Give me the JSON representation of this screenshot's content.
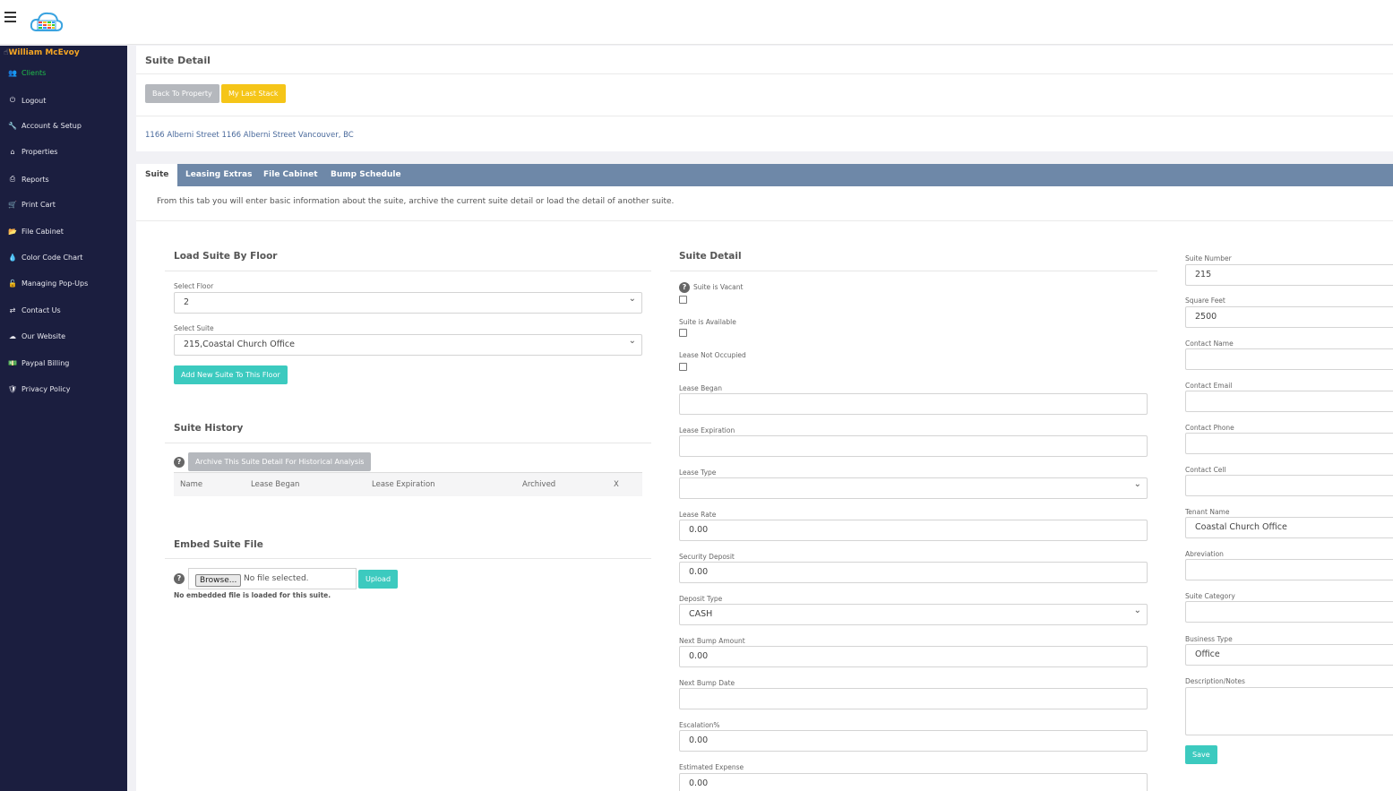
{
  "sidebar": {
    "user_name": "William McEvoy",
    "items": [
      {
        "label": "Clients",
        "icon": "users-icon",
        "glyph": "👥",
        "active": true
      },
      {
        "label": "Logout",
        "icon": "power-icon",
        "glyph": "⏻"
      },
      {
        "label": "Account & Setup",
        "icon": "wrench-icon",
        "glyph": "🔧"
      },
      {
        "label": "Properties",
        "icon": "home-icon",
        "glyph": "⌂"
      },
      {
        "label": "Reports",
        "icon": "print-icon",
        "glyph": "⎙"
      },
      {
        "label": "Print Cart",
        "icon": "cart-icon",
        "glyph": "🛒"
      },
      {
        "label": "File Cabinet",
        "icon": "folder-icon",
        "glyph": "📂"
      },
      {
        "label": "Color Code Chart",
        "icon": "drop-icon",
        "glyph": "💧"
      },
      {
        "label": "Managing Pop-Ups",
        "icon": "lock-icon",
        "glyph": "🔓"
      },
      {
        "label": "Contact Us",
        "icon": "exchange-icon",
        "glyph": "⇄"
      },
      {
        "label": "Our Website",
        "icon": "cloud-icon",
        "glyph": "☁"
      },
      {
        "label": "Paypal Billing",
        "icon": "money-icon",
        "glyph": "💵"
      },
      {
        "label": "Privacy Policy",
        "icon": "shield-icon",
        "glyph": "🛡"
      }
    ]
  },
  "header": {
    "title": "Suite Detail",
    "back_button": "Back To Property",
    "stack_button": "My Last Stack",
    "address": "1166 Alberni Street 1166 Alberni Street Vancouver, BC"
  },
  "tabs": [
    "Suite",
    "Leasing Extras",
    "File Cabinet",
    "Bump Schedule"
  ],
  "intro_text": "From this tab you will enter basic information about the suite, archive the current suite detail or load the detail of another suite.",
  "load_suite": {
    "title": "Load Suite By Floor",
    "floor_label": "Select Floor",
    "floor_value": "2",
    "suite_label": "Select Suite",
    "suite_value": "215,Coastal Church Office",
    "add_button": "Add New Suite To This Floor"
  },
  "history": {
    "title": "Suite History",
    "archive_button": "Archive This Suite Detail For Historical Analysis",
    "columns": [
      "Name",
      "Lease Began",
      "Lease Expiration",
      "Archived",
      "X"
    ]
  },
  "embed": {
    "title": "Embed Suite File",
    "browse_label": "Browse...",
    "no_file": "No file selected.",
    "upload_button": "Upload",
    "note": "No embedded file is loaded for this suite."
  },
  "suite_detail": {
    "title": "Suite Detail",
    "vacant_label": "Suite is Vacant",
    "available_label": "Suite is Available",
    "not_occupied_label": "Lease Not Occupied",
    "lease_began_label": "Lease Began",
    "lease_began_value": "",
    "lease_expiration_label": "Lease Expiration",
    "lease_expiration_value": "",
    "lease_type_label": "Lease Type",
    "lease_type_value": "",
    "lease_rate_label": "Lease Rate",
    "lease_rate_value": "0.00",
    "security_deposit_label": "Security Deposit",
    "security_deposit_value": "0.00",
    "deposit_type_label": "Deposit Type",
    "deposit_type_value": "CASH",
    "next_bump_amount_label": "Next Bump Amount",
    "next_bump_amount_value": "0.00",
    "next_bump_date_label": "Next Bump Date",
    "next_bump_date_value": "",
    "escalation_label": "Escalation%",
    "escalation_value": "0.00",
    "estimated_expense_label": "Estimated Expense",
    "estimated_expense_value": "0.00"
  },
  "suite_info": {
    "suite_number_label": "Suite Number",
    "suite_number_value": "215",
    "square_feet_label": "Square Feet",
    "square_feet_value": "2500",
    "contact_name_label": "Contact Name",
    "contact_name_value": "",
    "contact_email_label": "Contact Email",
    "contact_email_value": "",
    "contact_phone_label": "Contact Phone",
    "contact_phone_value": "",
    "contact_cell_label": "Contact Cell",
    "contact_cell_value": "",
    "tenant_name_label": "Tenant Name",
    "tenant_name_value": "Coastal Church Office",
    "abbreviation_label": "Abreviation",
    "abbreviation_value": "",
    "suite_category_label": "Suite Category",
    "suite_category_value": "",
    "business_type_label": "Business Type",
    "business_type_value": "Office",
    "description_label": "Description/Notes",
    "save_button": "Save"
  }
}
